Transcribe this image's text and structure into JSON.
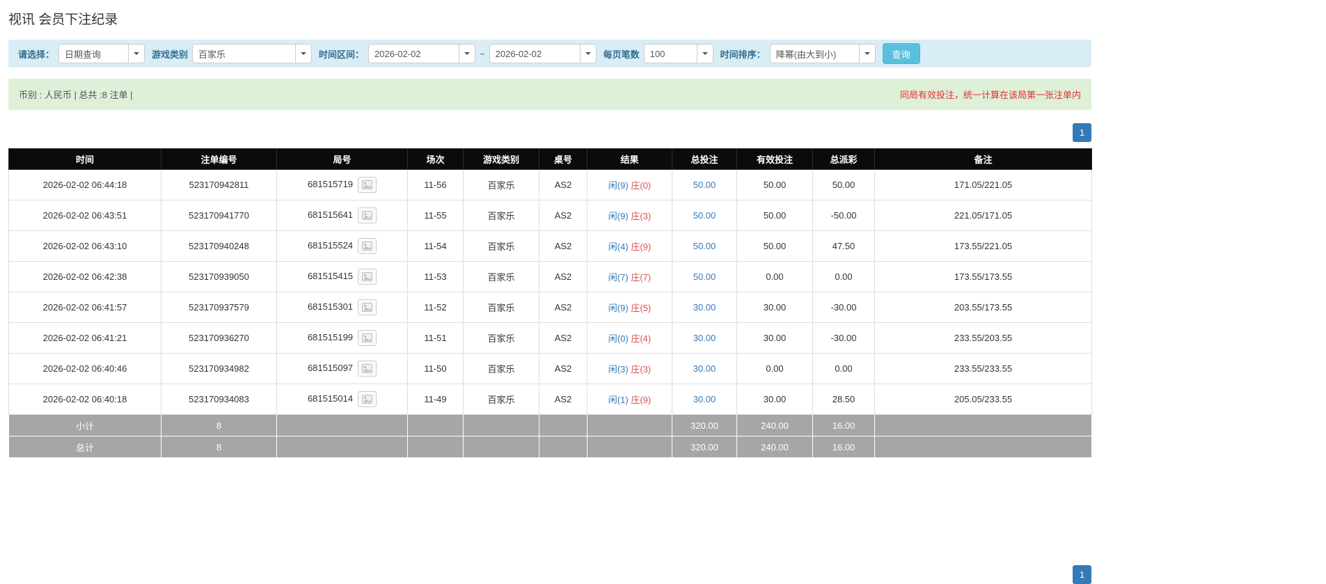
{
  "page": {
    "title": "视讯 会员下注纪录"
  },
  "filters": {
    "select_label": "请选择：",
    "select_value": "日期查询",
    "game_type_label": "游戏类别",
    "game_type_value": "百家乐",
    "time_range_label": "时间区间：",
    "date_from": "2026-02-02",
    "date_separator": "~",
    "date_to": "2026-02-02",
    "page_size_label": "每页笔数",
    "page_size_value": "100",
    "sort_label": "时间排序：",
    "sort_value": "降幂(由大到小)",
    "query_button_label": "查询"
  },
  "summary_bar": {
    "left_text": "币别 : 人民币 | 总共 :8 注单 |",
    "right_text": "同局有效投注，统一计算在该局第一张注单内"
  },
  "pagination": {
    "current_page": "1"
  },
  "table": {
    "headers": [
      "时间",
      "注单编号",
      "局号",
      "场次",
      "游戏类别",
      "桌号",
      "结果",
      "总投注",
      "有效投注",
      "总派彩",
      "备注"
    ],
    "rows": [
      {
        "time": "2026-02-02 06:44:18",
        "bet_id": "523170942811",
        "round_id": "681515719",
        "session": "11-56",
        "game": "百家乐",
        "table_no": "AS2",
        "result_player": "闲(9)",
        "result_banker": "庄(0)",
        "total_bet": "50.00",
        "valid_bet": "50.00",
        "payout": "50.00",
        "remark": "171.05/221.05"
      },
      {
        "time": "2026-02-02 06:43:51",
        "bet_id": "523170941770",
        "round_id": "681515641",
        "session": "11-55",
        "game": "百家乐",
        "table_no": "AS2",
        "result_player": "闲(9)",
        "result_banker": "庄(3)",
        "total_bet": "50.00",
        "valid_bet": "50.00",
        "payout": "-50.00",
        "remark": "221.05/171.05"
      },
      {
        "time": "2026-02-02 06:43:10",
        "bet_id": "523170940248",
        "round_id": "681515524",
        "session": "11-54",
        "game": "百家乐",
        "table_no": "AS2",
        "result_player": "闲(4)",
        "result_banker": "庄(9)",
        "total_bet": "50.00",
        "valid_bet": "50.00",
        "payout": "47.50",
        "remark": "173.55/221.05"
      },
      {
        "time": "2026-02-02 06:42:38",
        "bet_id": "523170939050",
        "round_id": "681515415",
        "session": "11-53",
        "game": "百家乐",
        "table_no": "AS2",
        "result_player": "闲(7)",
        "result_banker": "庄(7)",
        "total_bet": "50.00",
        "valid_bet": "0.00",
        "payout": "0.00",
        "remark": "173.55/173.55"
      },
      {
        "time": "2026-02-02 06:41:57",
        "bet_id": "523170937579",
        "round_id": "681515301",
        "session": "11-52",
        "game": "百家乐",
        "table_no": "AS2",
        "result_player": "闲(9)",
        "result_banker": "庄(5)",
        "total_bet": "30.00",
        "valid_bet": "30.00",
        "payout": "-30.00",
        "remark": "203.55/173.55"
      },
      {
        "time": "2026-02-02 06:41:21",
        "bet_id": "523170936270",
        "round_id": "681515199",
        "session": "11-51",
        "game": "百家乐",
        "table_no": "AS2",
        "result_player": "闲(0)",
        "result_banker": "庄(4)",
        "total_bet": "30.00",
        "valid_bet": "30.00",
        "payout": "-30.00",
        "remark": "233.55/203.55"
      },
      {
        "time": "2026-02-02 06:40:46",
        "bet_id": "523170934982",
        "round_id": "681515097",
        "session": "11-50",
        "game": "百家乐",
        "table_no": "AS2",
        "result_player": "闲(3)",
        "result_banker": "庄(3)",
        "total_bet": "30.00",
        "valid_bet": "0.00",
        "payout": "0.00",
        "remark": "233.55/233.55"
      },
      {
        "time": "2026-02-02 06:40:18",
        "bet_id": "523170934083",
        "round_id": "681515014",
        "session": "11-49",
        "game": "百家乐",
        "table_no": "AS2",
        "result_player": "闲(1)",
        "result_banker": "庄(9)",
        "total_bet": "30.00",
        "valid_bet": "30.00",
        "payout": "28.50",
        "remark": "205.05/233.55"
      }
    ],
    "subtotal": {
      "label": "小计",
      "count": "8",
      "total_bet": "320.00",
      "valid_bet": "240.00",
      "payout": "16.00"
    },
    "total": {
      "label": "总计",
      "count": "8",
      "total_bet": "320.00",
      "valid_bet": "240.00",
      "payout": "16.00"
    }
  },
  "colors": {
    "accent_blue": "#337ab7",
    "player_blue": "#337ab7",
    "banker_red": "#d9534f",
    "negative_red": "#e03131",
    "table_header_bg": "#0b0b0b",
    "filter_bar_bg": "#d9edf7",
    "summary_bar_bg": "#dff0d8",
    "summary_row_bg": "#a6a6a6",
    "query_button_bg": "#5bc0de"
  }
}
